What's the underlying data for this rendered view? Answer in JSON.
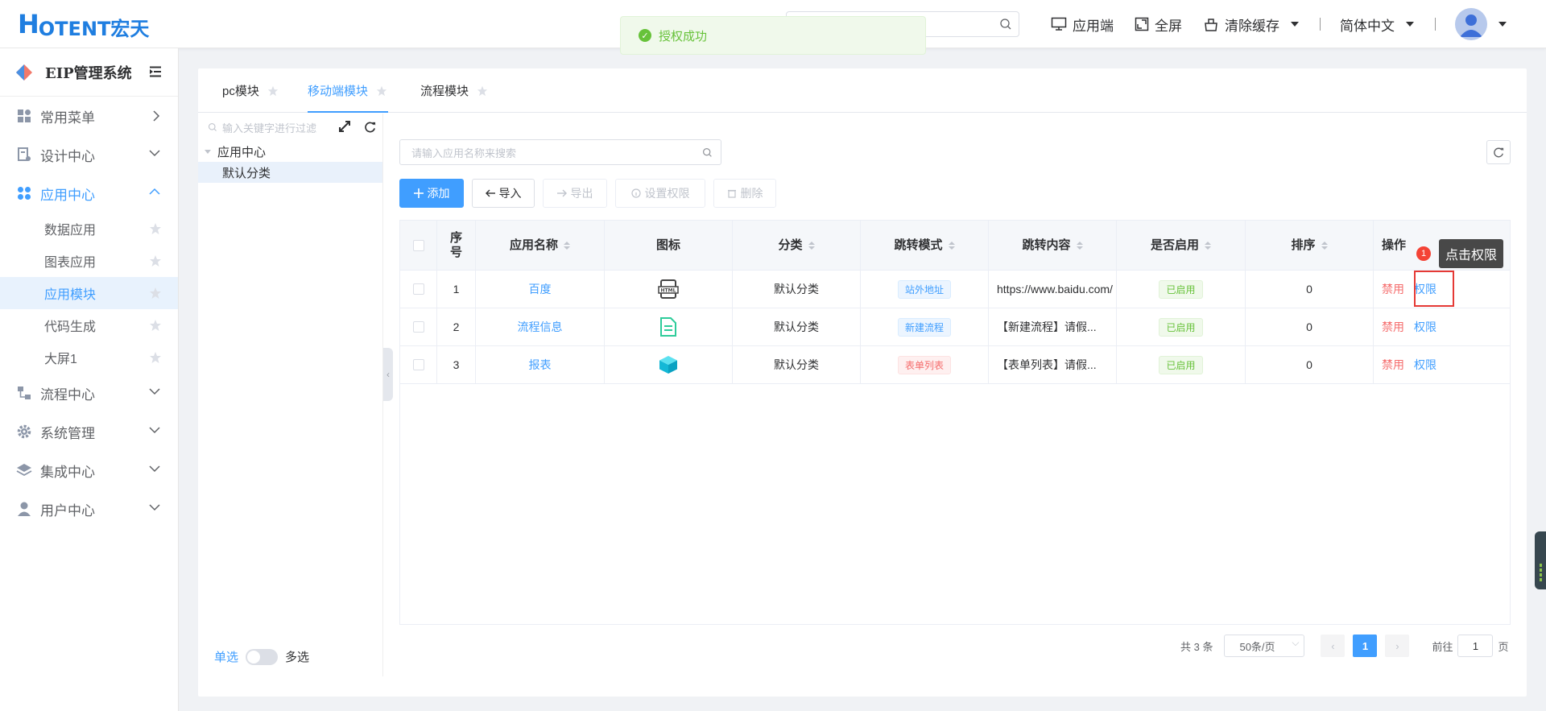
{
  "header": {
    "logo_mark": "H",
    "logo_text": "OTENT宏天",
    "search_placeholder": "",
    "items": [
      {
        "label": "应用端",
        "icon": "monitor-icon"
      },
      {
        "label": "全屏",
        "icon": "fullscreen-icon"
      },
      {
        "label": "清除缓存",
        "icon": "clear-cache-icon"
      }
    ],
    "language": "简体中文"
  },
  "toast": {
    "text": "授权成功",
    "color": "#67c23a"
  },
  "sidebar": {
    "title": "EIP管理系统",
    "menus": [
      {
        "label": "常用菜单",
        "icon": "dashboard-icon"
      },
      {
        "label": "设计中心",
        "icon": "design-icon"
      },
      {
        "label": "应用中心",
        "icon": "apps-icon"
      }
    ],
    "submenus": [
      {
        "label": "数据应用"
      },
      {
        "label": "图表应用"
      },
      {
        "label": "应用模块"
      },
      {
        "label": "代码生成"
      },
      {
        "label": "大屏1"
      }
    ],
    "menus_after": [
      {
        "label": "流程中心",
        "icon": "flow-icon"
      },
      {
        "label": "系统管理",
        "icon": "gear-icon"
      },
      {
        "label": "集成中心",
        "icon": "layers-icon"
      },
      {
        "label": "用户中心",
        "icon": "user-icon"
      }
    ]
  },
  "tabs": [
    {
      "label": "pc模块"
    },
    {
      "label": "移动端模块"
    },
    {
      "label": "流程模块"
    }
  ],
  "tree": {
    "filter_placeholder": "输入关键字进行过滤",
    "root": "应用中心",
    "child": "默认分类",
    "switch_left": "单选",
    "switch_right": "多选"
  },
  "search_app_placeholder": "请输入应用名称来搜索",
  "toolbar": {
    "add": "添加",
    "import": "导入",
    "export": "导出",
    "set_auth": "设置权限",
    "delete": "删除"
  },
  "table": {
    "columns": [
      "序号",
      "应用名称",
      "图标",
      "分类",
      "跳转模式",
      "跳转内容",
      "是否启用",
      "排序",
      "操作"
    ],
    "rows": [
      {
        "index": "1",
        "name": "百度",
        "icon": "html-file-icon",
        "category": "默认分类",
        "mode": "站外地址",
        "mode_color": "blue",
        "content": "https://www.baidu.com/",
        "enabled": "已启用",
        "sort": "0",
        "op1": "禁用",
        "op2": "权限"
      },
      {
        "index": "2",
        "name": "流程信息",
        "icon": "document-icon",
        "category": "默认分类",
        "mode": "新建流程",
        "mode_color": "blue",
        "content": "【新建流程】请假...",
        "enabled": "已启用",
        "sort": "0",
        "op1": "禁用",
        "op2": "权限"
      },
      {
        "index": "3",
        "name": "报表",
        "icon": "cube-icon",
        "category": "默认分类",
        "mode": "表单列表",
        "mode_color": "red",
        "content": "【表单列表】请假...",
        "enabled": "已启用",
        "sort": "0",
        "op1": "禁用",
        "op2": "权限"
      }
    ]
  },
  "tooltip": {
    "badge": "1",
    "text": "点击权限"
  },
  "pager": {
    "total": "共 3 条",
    "page_size": "50条/页",
    "current": "1",
    "goto_prefix": "前往",
    "goto_value": "1",
    "goto_suffix": "页"
  },
  "colors": {
    "primary": "#409eff",
    "danger": "#f56c6c",
    "success": "#67c23a"
  }
}
